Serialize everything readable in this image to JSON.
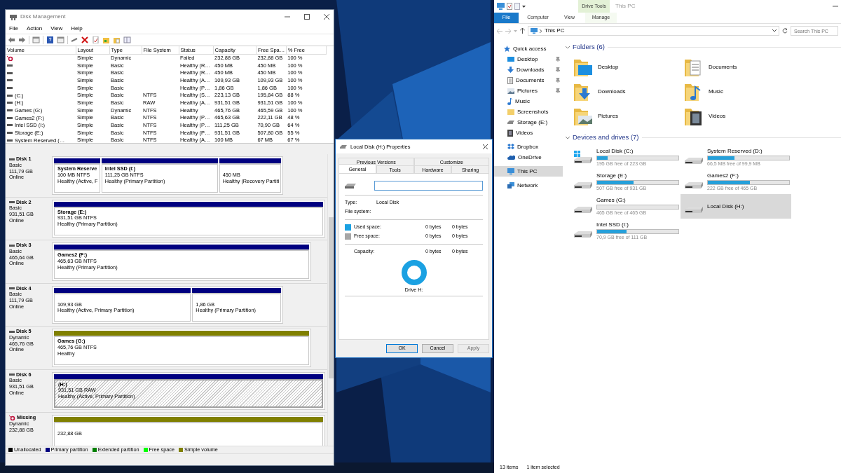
{
  "disk_management": {
    "title": "Disk Management",
    "menu": [
      "File",
      "Action",
      "View",
      "Help"
    ],
    "table": {
      "columns": [
        "Volume",
        "Layout",
        "Type",
        "File System",
        "Status",
        "Capacity",
        "Free Spa…",
        "% Free"
      ],
      "rows": [
        {
          "kind": "failed",
          "layout": "Simple",
          "type": "Dynamic",
          "status": "Failed",
          "capacity": "232,88 GB",
          "free": "232,88 GB",
          "percent": "100 %"
        },
        {
          "kind": "disk",
          "layout": "Simple",
          "type": "Basic",
          "status": "Healthy (R…",
          "capacity": "450 MB",
          "free": "450 MB",
          "percent": "100 %"
        },
        {
          "kind": "disk",
          "layout": "Simple",
          "type": "Basic",
          "status": "Healthy (R…",
          "capacity": "450 MB",
          "free": "450 MB",
          "percent": "100 %"
        },
        {
          "kind": "disk",
          "layout": "Simple",
          "type": "Basic",
          "status": "Healthy (A…",
          "capacity": "109,93 GB",
          "free": "109,93 GB",
          "percent": "100 %"
        },
        {
          "kind": "disk",
          "layout": "Simple",
          "type": "Basic",
          "status": "Healthy (P…",
          "capacity": "1,86 GB",
          "free": "1,86 GB",
          "percent": "100 %"
        },
        {
          "kind": "disk",
          "volume": "(C:)",
          "layout": "Simple",
          "type": "Basic",
          "file_system": "NTFS",
          "status": "Healthy (S…",
          "capacity": "223,13 GB",
          "free": "195,84 GB",
          "percent": "88 %"
        },
        {
          "kind": "disk",
          "volume": "(H:)",
          "layout": "Simple",
          "type": "Basic",
          "file_system": "RAW",
          "status": "Healthy (A…",
          "capacity": "931,51 GB",
          "free": "931,51 GB",
          "percent": "100 %"
        },
        {
          "kind": "disk",
          "volume": "Games (G:)",
          "layout": "Simple",
          "type": "Dynamic",
          "file_system": "NTFS",
          "status": "Healthy",
          "capacity": "465,76 GB",
          "free": "465,59 GB",
          "percent": "100 %"
        },
        {
          "kind": "disk",
          "volume": "Games2 (F:)",
          "layout": "Simple",
          "type": "Basic",
          "file_system": "NTFS",
          "status": "Healthy (P…",
          "capacity": "465,63 GB",
          "free": "222,11 GB",
          "percent": "48 %"
        },
        {
          "kind": "disk",
          "volume": "Intel SSD (I:)",
          "layout": "Simple",
          "type": "Basic",
          "file_system": "NTFS",
          "status": "Healthy (P…",
          "capacity": "111,25 GB",
          "free": "70,90 GB",
          "percent": "64 %"
        },
        {
          "kind": "disk",
          "volume": "Storage (E:)",
          "layout": "Simple",
          "type": "Basic",
          "file_system": "NTFS",
          "status": "Healthy (P…",
          "capacity": "931,51 GB",
          "free": "507,80 GB",
          "percent": "55 %"
        },
        {
          "kind": "disk",
          "volume": "System Reserved (…",
          "layout": "Simple",
          "type": "Basic",
          "file_system": "NTFS",
          "status": "Healthy (A…",
          "capacity": "100 MB",
          "free": "67 MB",
          "percent": "67 %"
        }
      ]
    },
    "disks": [
      {
        "kind": "disk",
        "name": "Disk 1",
        "type": "Basic",
        "size": "111,79 GB",
        "status": "Online",
        "partitions": [
          {
            "label": "System Reserve",
            "size": "100 MB NTFS",
            "status": "Healthy (Active, F",
            "color": "#000080",
            "selected": false
          },
          {
            "label": "Intel SSD  (I:)",
            "size": "111,25 GB NTFS",
            "status": "Healthy (Primary Partition)",
            "color": "#000080",
            "selected": false
          },
          {
            "size": "450 MB",
            "status": "Healthy (Recovery Partiti",
            "color": "#000080",
            "selected": false
          }
        ]
      },
      {
        "kind": "disk",
        "name": "Disk 2",
        "type": "Basic",
        "size": "931,51 GB",
        "status": "Online",
        "partitions": [
          {
            "label": "Storage  (E:)",
            "size": "931,51 GB NTFS",
            "status": "Healthy (Primary Partition)",
            "color": "#000080",
            "selected": false
          }
        ]
      },
      {
        "kind": "disk",
        "name": "Disk 3",
        "type": "Basic",
        "size": "465,64 GB",
        "status": "Online",
        "partitions": [
          {
            "label": "Games2  (F:)",
            "size": "465,63 GB NTFS",
            "status": "Healthy (Primary Partition)",
            "color": "#000080",
            "selected": false
          }
        ]
      },
      {
        "kind": "disk",
        "name": "Disk 4",
        "type": "Basic",
        "size": "111,79 GB",
        "status": "Online",
        "partitions": [
          {
            "size": "109,93 GB",
            "status": "Healthy (Active, Primary Partition)",
            "color": "#000080",
            "selected": false
          },
          {
            "size": "1,86 GB",
            "status": "Healthy (Primary Partition)",
            "color": "#000080",
            "selected": false
          }
        ]
      },
      {
        "kind": "disk",
        "name": "Disk 5",
        "type": "Dynamic",
        "size": "465,76 GB",
        "status": "Online",
        "partitions": [
          {
            "label": "Games  (G:)",
            "size": "465,76 GB NTFS",
            "status": "Healthy",
            "color": "#808000",
            "selected": false
          }
        ]
      },
      {
        "kind": "disk",
        "name": "Disk 6",
        "type": "Basic",
        "size": "931,51 GB",
        "status": "Online",
        "partitions": [
          {
            "label": "(H:)",
            "size": "931,51 GB RAW",
            "status": "Healthy (Active, Primary Partition)",
            "color": "#000080",
            "selected": true
          }
        ]
      },
      {
        "kind": "missing",
        "name": "Missing",
        "type": "Dynamic",
        "size": "232,88 GB",
        "partitions": [
          {
            "size": "232,88 GB",
            "color": "#808000",
            "selected": false
          }
        ]
      }
    ],
    "legend": [
      {
        "label": "Unallocated",
        "color": "#000000"
      },
      {
        "label": "Primary partition",
        "color": "#000080"
      },
      {
        "label": "Extended partition",
        "color": "#008000"
      },
      {
        "label": "Free space",
        "color": "#00ff00"
      },
      {
        "label": "Simple volume",
        "color": "#808000"
      }
    ]
  },
  "properties": {
    "title": "Local Disk (H:) Properties",
    "tab_rows": [
      {
        "tabs": [
          {
            "label": "Previous Versions",
            "selected": false
          },
          {
            "label": "Customize",
            "selected": false
          }
        ]
      },
      {
        "tabs": [
          {
            "label": "General",
            "selected": true
          },
          {
            "label": "Tools",
            "selected": false
          },
          {
            "label": "Hardware",
            "selected": false
          },
          {
            "label": "Sharing",
            "selected": false
          }
        ]
      }
    ],
    "type": {
      "label": "Type:",
      "value": "Local Disk"
    },
    "file_system": {
      "label": "File system:"
    },
    "space": [
      {
        "label": "Used space:",
        "color": "#1ba1e2",
        "bytes": "0 bytes",
        "size": "0 bytes"
      },
      {
        "label": "Free space:",
        "color": "#a6a6a6",
        "bytes": "0 bytes",
        "size": "0 bytes"
      }
    ],
    "capacity": {
      "label": "Capacity:",
      "bytes": "0 bytes",
      "size": "0 bytes"
    },
    "drive_label": "Drive H:",
    "buttons": [
      {
        "label": "OK",
        "default": true,
        "disabled": false
      },
      {
        "label": "Cancel",
        "default": false,
        "disabled": false
      },
      {
        "label": "Apply",
        "default": false,
        "disabled": true
      }
    ]
  },
  "explorer": {
    "context_tab": "Drive Tools",
    "title": "This PC",
    "ribbon_tabs": [
      {
        "label": "File",
        "kind": "file"
      },
      {
        "label": "Computer",
        "kind": "tab"
      },
      {
        "label": "View",
        "kind": "tab"
      },
      {
        "label": "Manage",
        "kind": "context"
      }
    ],
    "address": "This PC",
    "search": {
      "placeholder": "Search This PC"
    },
    "nav": [
      {
        "label": "Quick access",
        "kind": "star",
        "pinned": false,
        "selected": false
      },
      {
        "label": "Desktop",
        "kind": "desktop",
        "pinned": true,
        "selected": false
      },
      {
        "label": "Downloads",
        "kind": "download",
        "pinned": true,
        "selected": false
      },
      {
        "label": "Documents",
        "kind": "document",
        "pinned": true,
        "selected": false
      },
      {
        "label": "Pictures",
        "kind": "picture",
        "pinned": true,
        "selected": false
      },
      {
        "label": "Music",
        "kind": "music",
        "pinned": false,
        "selected": false
      },
      {
        "label": "Screenshots",
        "kind": "folder",
        "pinned": false,
        "selected": false
      },
      {
        "label": "Storage (E:)",
        "kind": "drive",
        "pinned": false,
        "selected": false
      },
      {
        "label": "Videos",
        "kind": "video",
        "pinned": false,
        "selected": false
      },
      {
        "label": "Dropbox",
        "kind": "dropbox",
        "pinned": false,
        "selected": false
      },
      {
        "label": "OneDrive",
        "kind": "cloud",
        "pinned": false,
        "selected": false
      },
      {
        "label": "This PC",
        "kind": "pc",
        "pinned": false,
        "selected": true
      },
      {
        "label": "Network",
        "kind": "network",
        "pinned": false,
        "selected": false
      }
    ],
    "folders": {
      "title": "Folders (6)",
      "expanded": true,
      "items": [
        {
          "label": "Desktop",
          "kind": "desktop"
        },
        {
          "label": "Documents",
          "kind": "document"
        },
        {
          "label": "Downloads",
          "kind": "download"
        },
        {
          "label": "Music",
          "kind": "music"
        },
        {
          "label": "Pictures",
          "kind": "picture"
        },
        {
          "label": "Videos",
          "kind": "video"
        }
      ]
    },
    "drives": {
      "title": "Devices and drives (7)",
      "expanded": true,
      "items": [
        {
          "label": "Local Disk (C:)",
          "kind": "system",
          "level": 0.13,
          "free": "195 GB free of 223 GB",
          "selected": false
        },
        {
          "label": "System Reserved (D:)",
          "kind": "disk",
          "level": 0.33,
          "free": "66,5 MB free of 99,9 MB",
          "selected": false
        },
        {
          "label": "Storage (E:)",
          "kind": "disk",
          "level": 0.45,
          "free": "507 GB free of 931 GB",
          "selected": false
        },
        {
          "label": "Games2 (F:)",
          "kind": "disk",
          "level": 0.52,
          "free": "222 GB free of 465 GB",
          "selected": false
        },
        {
          "label": "Games (G:)",
          "kind": "disk",
          "level": 0,
          "free": "465 GB free of 465 GB",
          "selected": false
        },
        {
          "label": "Local Disk (H:)",
          "kind": "disk",
          "selected": true
        },
        {
          "label": "Intel SSD  (I:)",
          "kind": "disk",
          "level": 0.36,
          "free": "70,9 GB free of 111 GB",
          "selected": false
        }
      ]
    },
    "status": [
      "13 items",
      "1 item selected"
    ]
  }
}
